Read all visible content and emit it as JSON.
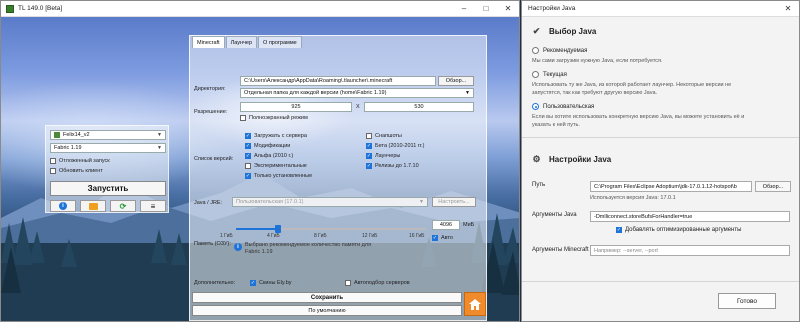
{
  "left_window": {
    "title": "TL 149.0 [Beta]",
    "controls": [
      "–",
      "□",
      "✕"
    ]
  },
  "launcher_panel": {
    "account": "Felix14_v2",
    "version": "Fabric 1.19",
    "deferred_start": "Отложенный запуск",
    "update_client": "Обновить клиент",
    "launch_button": "Запустить",
    "icons": [
      "info-icon",
      "folder-icon",
      "refresh-icon",
      "menu-icon"
    ]
  },
  "settings": {
    "tabs": [
      "Minecraft",
      "Лаунчер",
      "О программе"
    ],
    "directory": {
      "label": "Директория:",
      "value": "C:\\Users\\Александр\\AppData\\Roaming\\.tlauncher\\.minecraft",
      "browse": "Обзор...",
      "mode": "Отдельная папка для каждой версии (home\\Fabric 1.19)"
    },
    "resolution": {
      "label": "Разрешение:",
      "width": "925",
      "sep": "X",
      "height": "530",
      "fullscreen": "Полноэкранный режим"
    },
    "versions": {
      "label": "Список версий:",
      "items": [
        {
          "label": "Загружать с сервера",
          "checked": true
        },
        {
          "label": "Снапшоты",
          "checked": false
        },
        {
          "label": "Модификации",
          "checked": true
        },
        {
          "label": "Бета (2010-2011 гг.)",
          "checked": true
        },
        {
          "label": "Альфа (2010 г.)",
          "checked": true
        },
        {
          "label": "Лаунчеры",
          "checked": true
        },
        {
          "label": "Экспериментальные",
          "checked": false
        },
        {
          "label": "Релизы до 1.7.10",
          "checked": true
        },
        {
          "label": "Только установленные",
          "checked": true
        }
      ]
    },
    "java": {
      "label": "Java / JRE:",
      "value": "Пользовательская (17.0.1)",
      "configure": "Настроить..."
    },
    "memory": {
      "label": "Память (ОЗУ):",
      "value": "4096",
      "unit": "МиБ",
      "auto": "Авто",
      "ticks": [
        "1 ГиБ",
        "4 ГиБ",
        "8 ГиБ",
        "12 ГиБ",
        "16 ГиБ"
      ],
      "fill_fraction": 0.22,
      "recommended_note_line1": "Выбрано рекомендуемое количество памяти для",
      "recommended_note_line2": "Fabric 1.19"
    },
    "additional": {
      "label": "Дополнительно:",
      "skins": "Скины Ely.by",
      "autoconnect": "Автоподбор серверов"
    },
    "save_button": "Сохранить",
    "default_button": "По умолчанию"
  },
  "java_window": {
    "title": "Настройки Java",
    "controls": [
      "✕"
    ],
    "choice_section": "Выбор Java",
    "options": [
      {
        "label": "Рекомендуемая",
        "selected": false,
        "desc": [
          "Мы сами загрузим нужную Java, если потребуется."
        ]
      },
      {
        "label": "Текущая",
        "selected": false,
        "desc": [
          "Использовать ту же Java, из которой работает лаунчер. Некоторые версии не",
          "запустятся, так как требуют другую версию Java."
        ]
      },
      {
        "label": "Пользовательская",
        "selected": true,
        "desc": [
          "Если вы хотите использовать конкретную версию Java, вы можете установить её и",
          "указать к ней путь."
        ]
      }
    ],
    "settings_section": "Настройки Java",
    "path_label": "Путь",
    "path_value": "C:\\Program Files\\Eclipse Adoptium\\jdk-17.0.1.12-hotspot\\b",
    "path_browse": "Обзор...",
    "detected_version": "Используется версия Java: 17.0.1",
    "args_label": "Аргументы Java",
    "args_value": "-Dmlliconnect.storeBufsForHandler=true",
    "optimized_args": "Добавлять оптимизированные аргументы",
    "mc_args_label": "Аргументы Minecraft",
    "mc_args_placeholder": "Например: --server, --port",
    "done_button": "Готово"
  },
  "colors": {
    "accent": "#1e73d9",
    "home_button": "#f08a2a"
  }
}
